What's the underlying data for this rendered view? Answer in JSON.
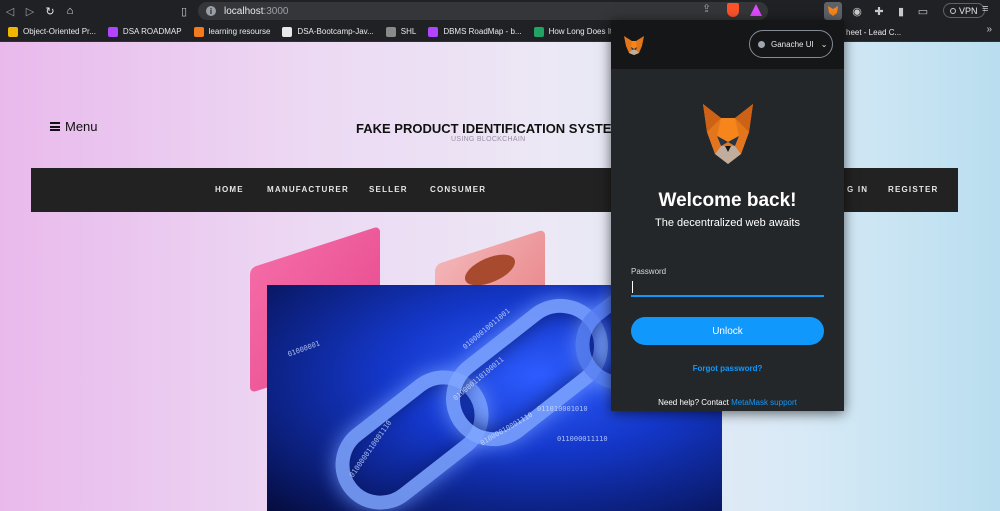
{
  "browser": {
    "url_host": "localhost",
    "url_port": ":3000",
    "vpn_label": "VPN"
  },
  "bookmarks": [
    {
      "label": "Object-Oriented Pr...",
      "color": "#f2b600"
    },
    {
      "label": "DSA ROADMAP",
      "color": "#b044ff"
    },
    {
      "label": "learning resourse",
      "color": "#f37a1e"
    },
    {
      "label": "DSA-Bootcamp-Jav...",
      "color": "#e8e8e8"
    },
    {
      "label": "SHL",
      "color": "#8a8a8a"
    },
    {
      "label": "DBMS RoadMap - b...",
      "color": "#b044ff"
    },
    {
      "label": "How Long Does It T...",
      "color": "#21a366"
    }
  ],
  "bookmark_overflow_text": "heet - Lead C...",
  "site": {
    "menu_label": "Menu",
    "title": "FAKE PRODUCT IDENTIFICATION SYSTE",
    "subtitle": "USING BLOCKCHAIN",
    "nav": [
      "HOME",
      "MANUFACTURER",
      "SELLER",
      "CONSUMER",
      "G IN",
      "REGISTER"
    ]
  },
  "image_bits": [
    "0100000110001110",
    "010000110100011",
    "01000010001110",
    "01000010011001",
    "011000011110",
    "011010001010",
    "011110",
    "01000001"
  ],
  "metamask": {
    "network": "Ganache UI",
    "welcome": "Welcome back!",
    "tagline": "The decentralized web awaits",
    "password_label": "Password",
    "password_value": "",
    "unlock_label": "Unlock",
    "forgot_label": "Forgot password?",
    "help_text": "Need help? Contact ",
    "help_link": "MetaMask support",
    "accent": "#1098fc"
  }
}
